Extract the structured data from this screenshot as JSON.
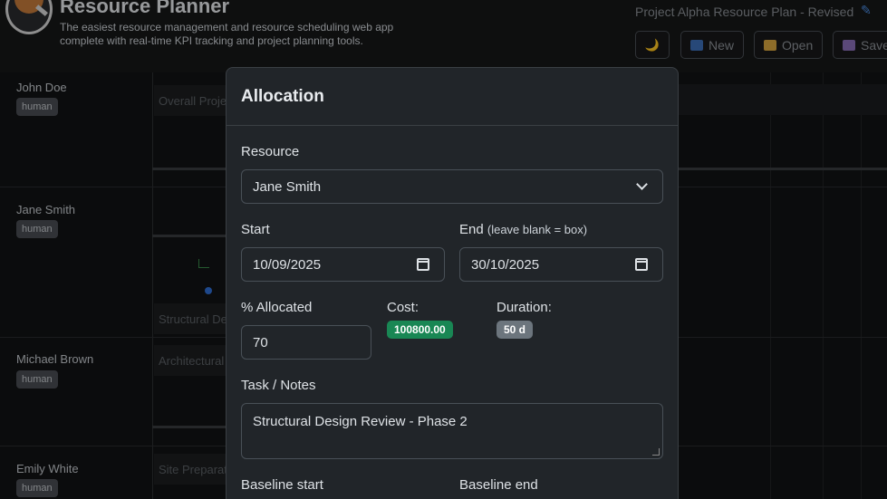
{
  "header": {
    "app_title": "Resource Planner",
    "subtitle": "The easiest resource management and resource scheduling web app complete with real-time KPI tracking and project planning tools.",
    "plan_name": "Project Alpha Resource Plan - Revised",
    "buttons": {
      "theme": "🌙",
      "new": "New",
      "open": "Open",
      "save": "Save"
    }
  },
  "rows": [
    {
      "name": "John Doe",
      "tag": "human",
      "task": "Overall Project"
    },
    {
      "name": "Jane Smith",
      "tag": "human",
      "task": "Structural Design"
    },
    {
      "name": "Michael Brown",
      "tag": "human",
      "task": "Architectural"
    },
    {
      "name": "Emily White",
      "tag": "human",
      "task": "Site Preparation"
    }
  ],
  "modal": {
    "title": "Allocation",
    "resource_label": "Resource",
    "resource_value": "Jane Smith",
    "start_label": "Start",
    "start_value": "10/09/2025",
    "end_label": "End",
    "end_hint": "(leave blank = box)",
    "end_value": "30/10/2025",
    "percent_label": "% Allocated",
    "percent_value": "70",
    "cost_label": "Cost:",
    "cost_value": "100800.00",
    "duration_label": "Duration:",
    "duration_value": "50 d",
    "notes_label": "Task / Notes",
    "notes_value": "Structural Design Review - Phase 2",
    "baseline_start_label": "Baseline start",
    "baseline_end_label": "Baseline end"
  },
  "colors": {
    "cost_badge": "#198754",
    "duration_badge": "#6c757d",
    "accent": "#4d8fe6"
  }
}
